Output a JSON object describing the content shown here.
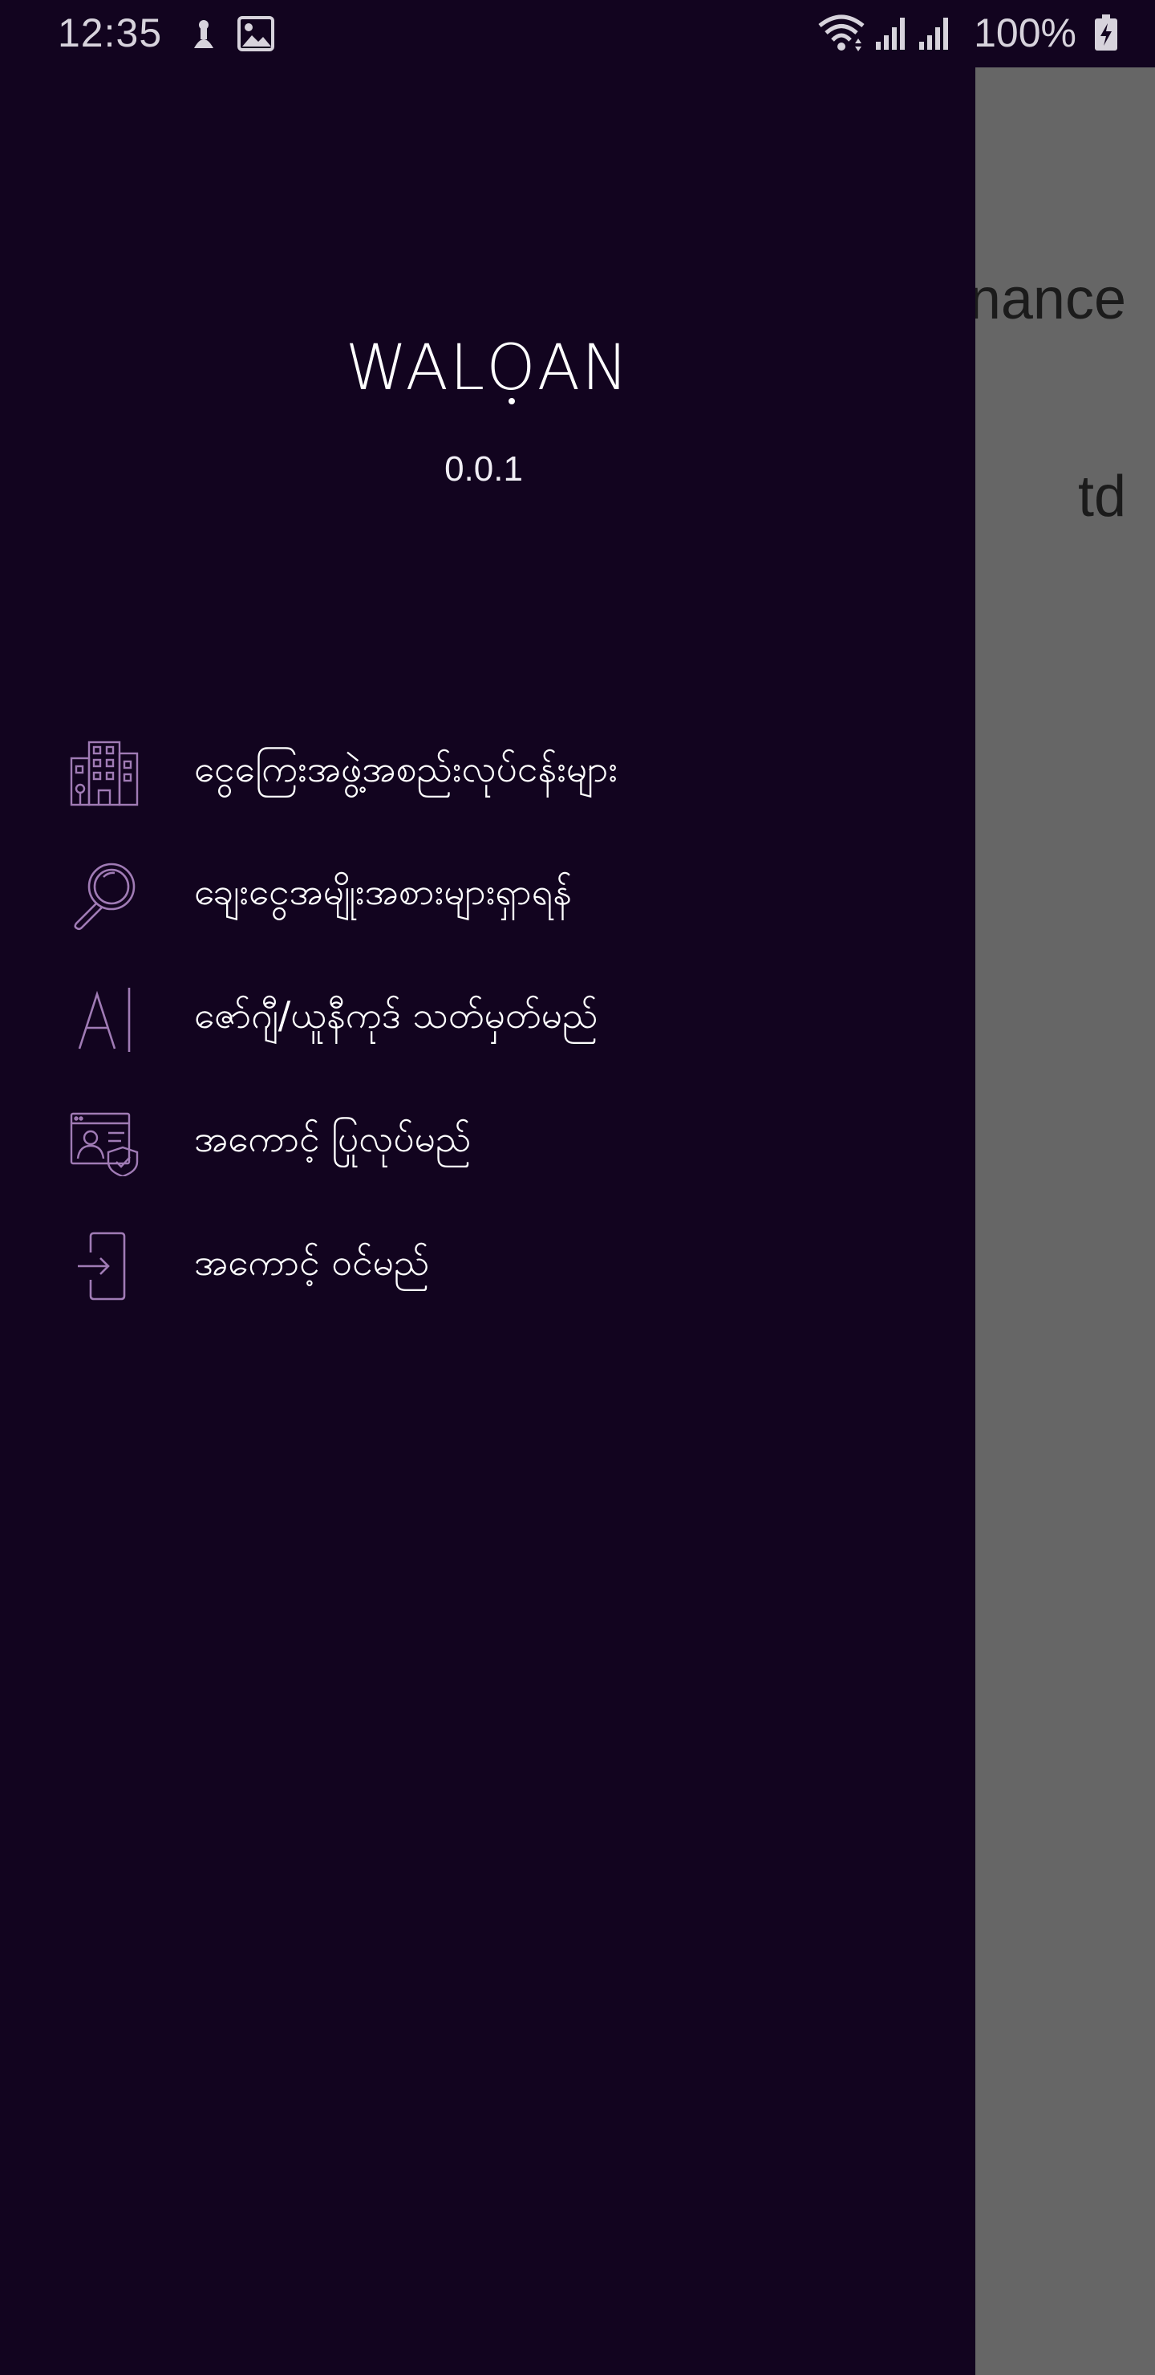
{
  "status_bar": {
    "time": "12:35",
    "battery": "100%",
    "icons": [
      "usb-icon",
      "image-icon",
      "wifi-icon",
      "signal-icon",
      "signal-icon",
      "battery-charging-icon"
    ]
  },
  "background_app": {
    "text_line_1": "nance",
    "text_line_2": "td"
  },
  "drawer": {
    "brand_prefix": "WAL",
    "brand_o": "O",
    "brand_suffix": "AN",
    "version": "0.0.1",
    "menu": [
      {
        "icon": "building-icon",
        "label": "ငွေကြေးအဖွဲ့အစည်းလုပ်ငန်းများ"
      },
      {
        "icon": "search-icon",
        "label": "ချေးငွေအမျိုးအစားများရှာရန်"
      },
      {
        "icon": "font-icon",
        "label": "ဇော်ဂျီ/ယူနီကုဒ် သတ်မှတ်မည်"
      },
      {
        "icon": "register-account-icon",
        "label": "အကောင့် ပြုလုပ်မည်"
      },
      {
        "icon": "login-icon",
        "label": "အကောင့် ဝင်မည်"
      }
    ]
  },
  "colors": {
    "drawer_bg": "#12041f",
    "icon_accent": "#a07bb5",
    "scrim": "#666666"
  }
}
